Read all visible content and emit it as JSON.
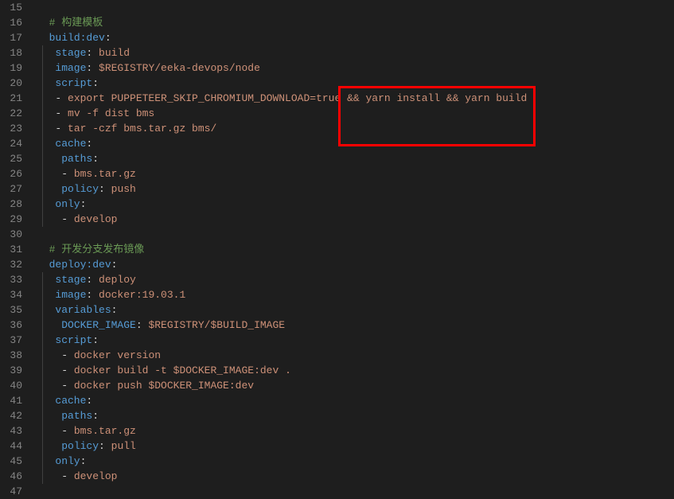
{
  "lines": [
    {
      "n": 15,
      "tokens": []
    },
    {
      "n": 16,
      "tokens": [
        {
          "t": "  ",
          "c": ""
        },
        {
          "t": "# 构建模板",
          "c": "comment"
        }
      ]
    },
    {
      "n": 17,
      "tokens": [
        {
          "t": "  ",
          "c": ""
        },
        {
          "t": "build:dev",
          "c": "key"
        },
        {
          "t": ":",
          "c": "punct"
        }
      ]
    },
    {
      "n": 18,
      "tokens": [
        {
          "t": "   ",
          "c": ""
        },
        {
          "t": "stage",
          "c": "key"
        },
        {
          "t": ": ",
          "c": "punct"
        },
        {
          "t": "build",
          "c": "str"
        }
      ],
      "guide": true
    },
    {
      "n": 19,
      "tokens": [
        {
          "t": "   ",
          "c": ""
        },
        {
          "t": "image",
          "c": "key"
        },
        {
          "t": ": ",
          "c": "punct"
        },
        {
          "t": "$REGISTRY/eeka-devops/node",
          "c": "str"
        }
      ],
      "guide": true
    },
    {
      "n": 20,
      "tokens": [
        {
          "t": "   ",
          "c": ""
        },
        {
          "t": "script",
          "c": "key"
        },
        {
          "t": ":",
          "c": "punct"
        }
      ],
      "guide": true
    },
    {
      "n": 21,
      "tokens": [
        {
          "t": "   ",
          "c": ""
        },
        {
          "t": "- ",
          "c": "punct"
        },
        {
          "t": "export PUPPETEER_SKIP_CHROMIUM_DOWNLOAD=true && yarn install && yarn build",
          "c": "str"
        }
      ],
      "guide": true
    },
    {
      "n": 22,
      "tokens": [
        {
          "t": "   ",
          "c": ""
        },
        {
          "t": "- ",
          "c": "punct"
        },
        {
          "t": "mv -f dist bms",
          "c": "str"
        }
      ],
      "guide": true
    },
    {
      "n": 23,
      "tokens": [
        {
          "t": "   ",
          "c": ""
        },
        {
          "t": "- ",
          "c": "punct"
        },
        {
          "t": "tar -czf bms.tar.gz bms/",
          "c": "str"
        }
      ],
      "guide": true
    },
    {
      "n": 24,
      "tokens": [
        {
          "t": "   ",
          "c": ""
        },
        {
          "t": "cache",
          "c": "key"
        },
        {
          "t": ":",
          "c": "punct"
        }
      ],
      "guide": true
    },
    {
      "n": 25,
      "tokens": [
        {
          "t": "    ",
          "c": ""
        },
        {
          "t": "paths",
          "c": "key"
        },
        {
          "t": ":",
          "c": "punct"
        }
      ],
      "guide": true
    },
    {
      "n": 26,
      "tokens": [
        {
          "t": "    ",
          "c": ""
        },
        {
          "t": "- ",
          "c": "punct"
        },
        {
          "t": "bms.tar.gz",
          "c": "str"
        }
      ],
      "guide": true
    },
    {
      "n": 27,
      "tokens": [
        {
          "t": "    ",
          "c": ""
        },
        {
          "t": "policy",
          "c": "key"
        },
        {
          "t": ": ",
          "c": "punct"
        },
        {
          "t": "push",
          "c": "str"
        }
      ],
      "guide": true
    },
    {
      "n": 28,
      "tokens": [
        {
          "t": "   ",
          "c": ""
        },
        {
          "t": "only",
          "c": "key"
        },
        {
          "t": ":",
          "c": "punct"
        }
      ],
      "guide": true
    },
    {
      "n": 29,
      "tokens": [
        {
          "t": "    ",
          "c": ""
        },
        {
          "t": "- ",
          "c": "punct"
        },
        {
          "t": "develop",
          "c": "str"
        }
      ],
      "guide": true
    },
    {
      "n": 30,
      "tokens": []
    },
    {
      "n": 31,
      "tokens": [
        {
          "t": "  ",
          "c": ""
        },
        {
          "t": "# 开发分支发布镜像",
          "c": "comment"
        }
      ]
    },
    {
      "n": 32,
      "tokens": [
        {
          "t": "  ",
          "c": ""
        },
        {
          "t": "deploy:dev",
          "c": "key"
        },
        {
          "t": ":",
          "c": "punct"
        }
      ]
    },
    {
      "n": 33,
      "tokens": [
        {
          "t": "   ",
          "c": ""
        },
        {
          "t": "stage",
          "c": "key"
        },
        {
          "t": ": ",
          "c": "punct"
        },
        {
          "t": "deploy",
          "c": "str"
        }
      ],
      "guide": true
    },
    {
      "n": 34,
      "tokens": [
        {
          "t": "   ",
          "c": ""
        },
        {
          "t": "image",
          "c": "key"
        },
        {
          "t": ": ",
          "c": "punct"
        },
        {
          "t": "docker:19.03.1",
          "c": "str"
        }
      ],
      "guide": true
    },
    {
      "n": 35,
      "tokens": [
        {
          "t": "   ",
          "c": ""
        },
        {
          "t": "variables",
          "c": "key"
        },
        {
          "t": ":",
          "c": "punct"
        }
      ],
      "guide": true
    },
    {
      "n": 36,
      "tokens": [
        {
          "t": "    ",
          "c": ""
        },
        {
          "t": "DOCKER_IMAGE",
          "c": "key"
        },
        {
          "t": ": ",
          "c": "punct"
        },
        {
          "t": "$REGISTRY/$BUILD_IMAGE",
          "c": "str"
        }
      ],
      "guide": true
    },
    {
      "n": 37,
      "tokens": [
        {
          "t": "   ",
          "c": ""
        },
        {
          "t": "script",
          "c": "key"
        },
        {
          "t": ":",
          "c": "punct"
        }
      ],
      "guide": true
    },
    {
      "n": 38,
      "tokens": [
        {
          "t": "    ",
          "c": ""
        },
        {
          "t": "- ",
          "c": "punct"
        },
        {
          "t": "docker version",
          "c": "str"
        }
      ],
      "guide": true
    },
    {
      "n": 39,
      "tokens": [
        {
          "t": "    ",
          "c": ""
        },
        {
          "t": "- ",
          "c": "punct"
        },
        {
          "t": "docker build -t $DOCKER_IMAGE:dev .",
          "c": "str"
        }
      ],
      "guide": true
    },
    {
      "n": 40,
      "tokens": [
        {
          "t": "    ",
          "c": ""
        },
        {
          "t": "- ",
          "c": "punct"
        },
        {
          "t": "docker push $DOCKER_IMAGE:dev",
          "c": "str"
        }
      ],
      "guide": true
    },
    {
      "n": 41,
      "tokens": [
        {
          "t": "   ",
          "c": ""
        },
        {
          "t": "cache",
          "c": "key"
        },
        {
          "t": ":",
          "c": "punct"
        }
      ],
      "guide": true
    },
    {
      "n": 42,
      "tokens": [
        {
          "t": "    ",
          "c": ""
        },
        {
          "t": "paths",
          "c": "key"
        },
        {
          "t": ":",
          "c": "punct"
        }
      ],
      "guide": true
    },
    {
      "n": 43,
      "tokens": [
        {
          "t": "    ",
          "c": ""
        },
        {
          "t": "- ",
          "c": "punct"
        },
        {
          "t": "bms.tar.gz",
          "c": "str"
        }
      ],
      "guide": true
    },
    {
      "n": 44,
      "tokens": [
        {
          "t": "    ",
          "c": ""
        },
        {
          "t": "policy",
          "c": "key"
        },
        {
          "t": ": ",
          "c": "punct"
        },
        {
          "t": "pull",
          "c": "str"
        }
      ],
      "guide": true
    },
    {
      "n": 45,
      "tokens": [
        {
          "t": "   ",
          "c": ""
        },
        {
          "t": "only",
          "c": "key"
        },
        {
          "t": ":",
          "c": "punct"
        }
      ],
      "guide": true
    },
    {
      "n": 46,
      "tokens": [
        {
          "t": "    ",
          "c": ""
        },
        {
          "t": "- ",
          "c": "punct"
        },
        {
          "t": "develop",
          "c": "str"
        }
      ],
      "guide": true
    },
    {
      "n": 47,
      "tokens": []
    }
  ]
}
